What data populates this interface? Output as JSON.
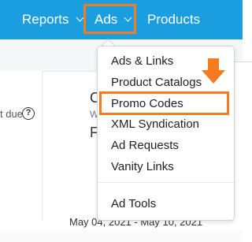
{
  "nav": {
    "reports": "Reports",
    "ads": "Ads",
    "products": "Products"
  },
  "background": {
    "due_label": "t due",
    "help_glyph": "?",
    "frag1": "C",
    "frag2": "W",
    "frag3": "F",
    "date_range": "May 04, 2021 - May 10, 2021"
  },
  "menu": {
    "items": [
      "Ads & Links",
      "Product Catalogs",
      "Promo Codes",
      "XML Syndication",
      "Ad Requests",
      "Vanity Links"
    ],
    "footer_item": "Ad Tools"
  },
  "colors": {
    "nav_bg": "#1a9ee0",
    "highlight": "#f47b20"
  },
  "icons": {
    "nav_chevron": "chevron-down-icon",
    "help": "help-icon",
    "annotation": "arrow-down-icon"
  }
}
